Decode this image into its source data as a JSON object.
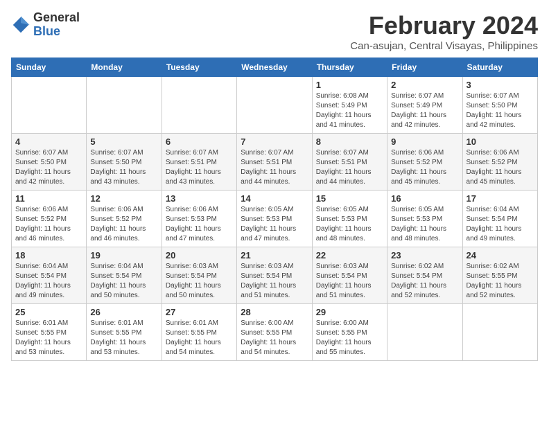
{
  "logo": {
    "general": "General",
    "blue": "Blue"
  },
  "title": {
    "month_year": "February 2024",
    "location": "Can-asujan, Central Visayas, Philippines"
  },
  "weekdays": [
    "Sunday",
    "Monday",
    "Tuesday",
    "Wednesday",
    "Thursday",
    "Friday",
    "Saturday"
  ],
  "weeks": [
    [
      {
        "day": "",
        "info": ""
      },
      {
        "day": "",
        "info": ""
      },
      {
        "day": "",
        "info": ""
      },
      {
        "day": "",
        "info": ""
      },
      {
        "day": "1",
        "info": "Sunrise: 6:08 AM\nSunset: 5:49 PM\nDaylight: 11 hours\nand 41 minutes."
      },
      {
        "day": "2",
        "info": "Sunrise: 6:07 AM\nSunset: 5:49 PM\nDaylight: 11 hours\nand 42 minutes."
      },
      {
        "day": "3",
        "info": "Sunrise: 6:07 AM\nSunset: 5:50 PM\nDaylight: 11 hours\nand 42 minutes."
      }
    ],
    [
      {
        "day": "4",
        "info": "Sunrise: 6:07 AM\nSunset: 5:50 PM\nDaylight: 11 hours\nand 42 minutes."
      },
      {
        "day": "5",
        "info": "Sunrise: 6:07 AM\nSunset: 5:50 PM\nDaylight: 11 hours\nand 43 minutes."
      },
      {
        "day": "6",
        "info": "Sunrise: 6:07 AM\nSunset: 5:51 PM\nDaylight: 11 hours\nand 43 minutes."
      },
      {
        "day": "7",
        "info": "Sunrise: 6:07 AM\nSunset: 5:51 PM\nDaylight: 11 hours\nand 44 minutes."
      },
      {
        "day": "8",
        "info": "Sunrise: 6:07 AM\nSunset: 5:51 PM\nDaylight: 11 hours\nand 44 minutes."
      },
      {
        "day": "9",
        "info": "Sunrise: 6:06 AM\nSunset: 5:52 PM\nDaylight: 11 hours\nand 45 minutes."
      },
      {
        "day": "10",
        "info": "Sunrise: 6:06 AM\nSunset: 5:52 PM\nDaylight: 11 hours\nand 45 minutes."
      }
    ],
    [
      {
        "day": "11",
        "info": "Sunrise: 6:06 AM\nSunset: 5:52 PM\nDaylight: 11 hours\nand 46 minutes."
      },
      {
        "day": "12",
        "info": "Sunrise: 6:06 AM\nSunset: 5:52 PM\nDaylight: 11 hours\nand 46 minutes."
      },
      {
        "day": "13",
        "info": "Sunrise: 6:06 AM\nSunset: 5:53 PM\nDaylight: 11 hours\nand 47 minutes."
      },
      {
        "day": "14",
        "info": "Sunrise: 6:05 AM\nSunset: 5:53 PM\nDaylight: 11 hours\nand 47 minutes."
      },
      {
        "day": "15",
        "info": "Sunrise: 6:05 AM\nSunset: 5:53 PM\nDaylight: 11 hours\nand 48 minutes."
      },
      {
        "day": "16",
        "info": "Sunrise: 6:05 AM\nSunset: 5:53 PM\nDaylight: 11 hours\nand 48 minutes."
      },
      {
        "day": "17",
        "info": "Sunrise: 6:04 AM\nSunset: 5:54 PM\nDaylight: 11 hours\nand 49 minutes."
      }
    ],
    [
      {
        "day": "18",
        "info": "Sunrise: 6:04 AM\nSunset: 5:54 PM\nDaylight: 11 hours\nand 49 minutes."
      },
      {
        "day": "19",
        "info": "Sunrise: 6:04 AM\nSunset: 5:54 PM\nDaylight: 11 hours\nand 50 minutes."
      },
      {
        "day": "20",
        "info": "Sunrise: 6:03 AM\nSunset: 5:54 PM\nDaylight: 11 hours\nand 50 minutes."
      },
      {
        "day": "21",
        "info": "Sunrise: 6:03 AM\nSunset: 5:54 PM\nDaylight: 11 hours\nand 51 minutes."
      },
      {
        "day": "22",
        "info": "Sunrise: 6:03 AM\nSunset: 5:54 PM\nDaylight: 11 hours\nand 51 minutes."
      },
      {
        "day": "23",
        "info": "Sunrise: 6:02 AM\nSunset: 5:54 PM\nDaylight: 11 hours\nand 52 minutes."
      },
      {
        "day": "24",
        "info": "Sunrise: 6:02 AM\nSunset: 5:55 PM\nDaylight: 11 hours\nand 52 minutes."
      }
    ],
    [
      {
        "day": "25",
        "info": "Sunrise: 6:01 AM\nSunset: 5:55 PM\nDaylight: 11 hours\nand 53 minutes."
      },
      {
        "day": "26",
        "info": "Sunrise: 6:01 AM\nSunset: 5:55 PM\nDaylight: 11 hours\nand 53 minutes."
      },
      {
        "day": "27",
        "info": "Sunrise: 6:01 AM\nSunset: 5:55 PM\nDaylight: 11 hours\nand 54 minutes."
      },
      {
        "day": "28",
        "info": "Sunrise: 6:00 AM\nSunset: 5:55 PM\nDaylight: 11 hours\nand 54 minutes."
      },
      {
        "day": "29",
        "info": "Sunrise: 6:00 AM\nSunset: 5:55 PM\nDaylight: 11 hours\nand 55 minutes."
      },
      {
        "day": "",
        "info": ""
      },
      {
        "day": "",
        "info": ""
      }
    ]
  ]
}
